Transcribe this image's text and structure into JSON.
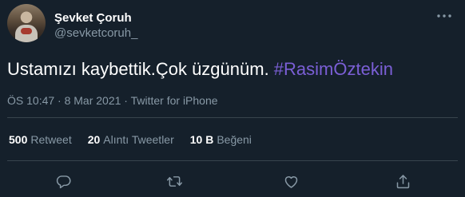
{
  "author": {
    "display_name": "Şevket Çoruh",
    "handle": "@sevketcoruh_",
    "avatar_icon": "profile-photo"
  },
  "tweet": {
    "text": "Ustamızı kaybettik.Çok üzgünüm. ",
    "hashtag": "#RasimÖztekin",
    "timestamp": "ÖS 10:47 · 8 Mar 2021 · Twitter for iPhone"
  },
  "stats": {
    "retweets_count": "500",
    "retweets_label": "Retweet",
    "quotes_count": "20",
    "quotes_label": "Alıntı Tweetler",
    "likes_count": "10 B",
    "likes_label": "Beğeni"
  },
  "actions": {
    "icons": [
      "reply-icon",
      "retweet-icon",
      "like-icon",
      "share-icon"
    ]
  },
  "colors": {
    "background": "#15202b",
    "primary_text": "#ffffff",
    "secondary_text": "#8899a6",
    "hashtag": "#7b5fd6",
    "divider": "#38444d"
  }
}
